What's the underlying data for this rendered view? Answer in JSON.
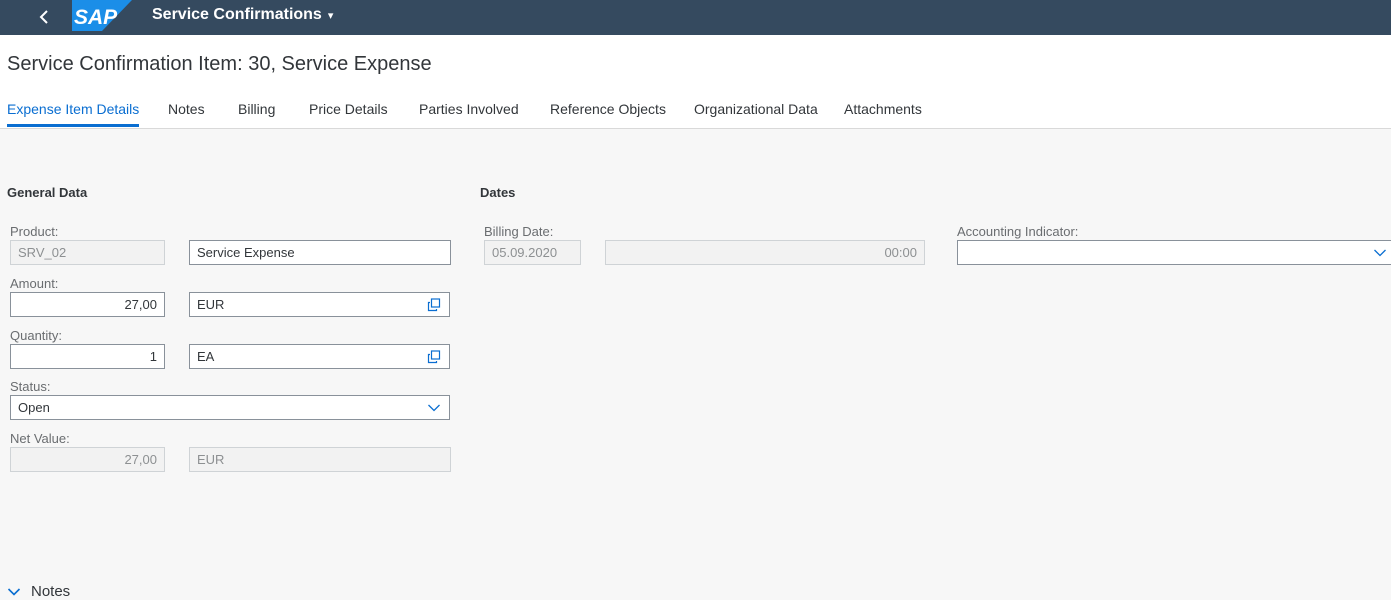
{
  "shell": {
    "logo_text": "SAP",
    "app_title": "Service Confirmations",
    "caret": "▾"
  },
  "page": {
    "title": "Service Confirmation Item: 30, Service Expense"
  },
  "tabs": [
    {
      "label": "Expense Item Details",
      "active": true
    },
    {
      "label": "Notes"
    },
    {
      "label": "Billing"
    },
    {
      "label": "Price Details"
    },
    {
      "label": "Parties Involved"
    },
    {
      "label": "Reference Objects"
    },
    {
      "label": "Organizational Data"
    },
    {
      "label": "Attachments"
    }
  ],
  "general_data": {
    "title": "General Data",
    "product_label": "Product:",
    "product_id": "SRV_02",
    "product_description": "Service Expense",
    "amount_label": "Amount:",
    "amount_value": "27,00",
    "amount_currency": "EUR",
    "quantity_label": "Quantity:",
    "quantity_value": "1",
    "quantity_unit": "EA",
    "status_label": "Status:",
    "status_value": "Open",
    "net_value_label": "Net Value:",
    "net_value": "27,00",
    "net_value_currency": "EUR"
  },
  "dates": {
    "title": "Dates",
    "billing_date_label": "Billing Date:",
    "billing_date": "05.09.2020",
    "billing_time": "00:00"
  },
  "accounting": {
    "label": "Accounting Indicator:",
    "value": ""
  },
  "notes_section": {
    "label": "Notes"
  },
  "colors": {
    "shell_bg": "#354a5f",
    "accent": "#0a6ed1",
    "page_bg": "#f7f7f7"
  },
  "icons": {
    "back": "chevron-left-icon",
    "value_help": "value-help-icon",
    "dropdown": "chevron-down-icon",
    "collapse": "chevron-down-icon"
  }
}
